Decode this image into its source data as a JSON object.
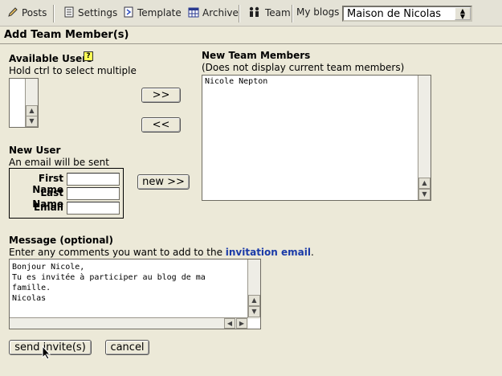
{
  "toolbar": {
    "posts": "Posts",
    "settings": "Settings",
    "template": "Template",
    "archive": "Archive",
    "team": "Team",
    "my_blogs_label": "My blogs",
    "blog_selected": "Maison de Nicolas"
  },
  "page": {
    "title": "Add Team Member(s)"
  },
  "available_users": {
    "title": "Available Users",
    "hint": "Hold ctrl to select multiple",
    "items": []
  },
  "move_buttons": {
    "add": ">>",
    "remove": "<<"
  },
  "new_team_members": {
    "title": "New Team Members",
    "subtitle": "(Does not display current team members)",
    "items": [
      "Nicole Nepton"
    ]
  },
  "new_user": {
    "title": "New User",
    "hint": "An email will be sent",
    "first_name_label": "First Name",
    "last_name_label": "Last Name",
    "email_label": "Email",
    "first_name_value": "",
    "last_name_value": "",
    "email_value": "",
    "new_button": "new >>"
  },
  "message": {
    "title": "Message (optional)",
    "hint_prefix": "Enter any comments you want to add to the ",
    "hint_link": "invitation email",
    "hint_suffix": ".",
    "lines": [
      "Bonjour Nicole,",
      "Tu es invitée à participer au blog de ma",
      "famille.",
      "Nicolas"
    ]
  },
  "actions": {
    "send": "send invite(s)",
    "cancel": "cancel"
  }
}
